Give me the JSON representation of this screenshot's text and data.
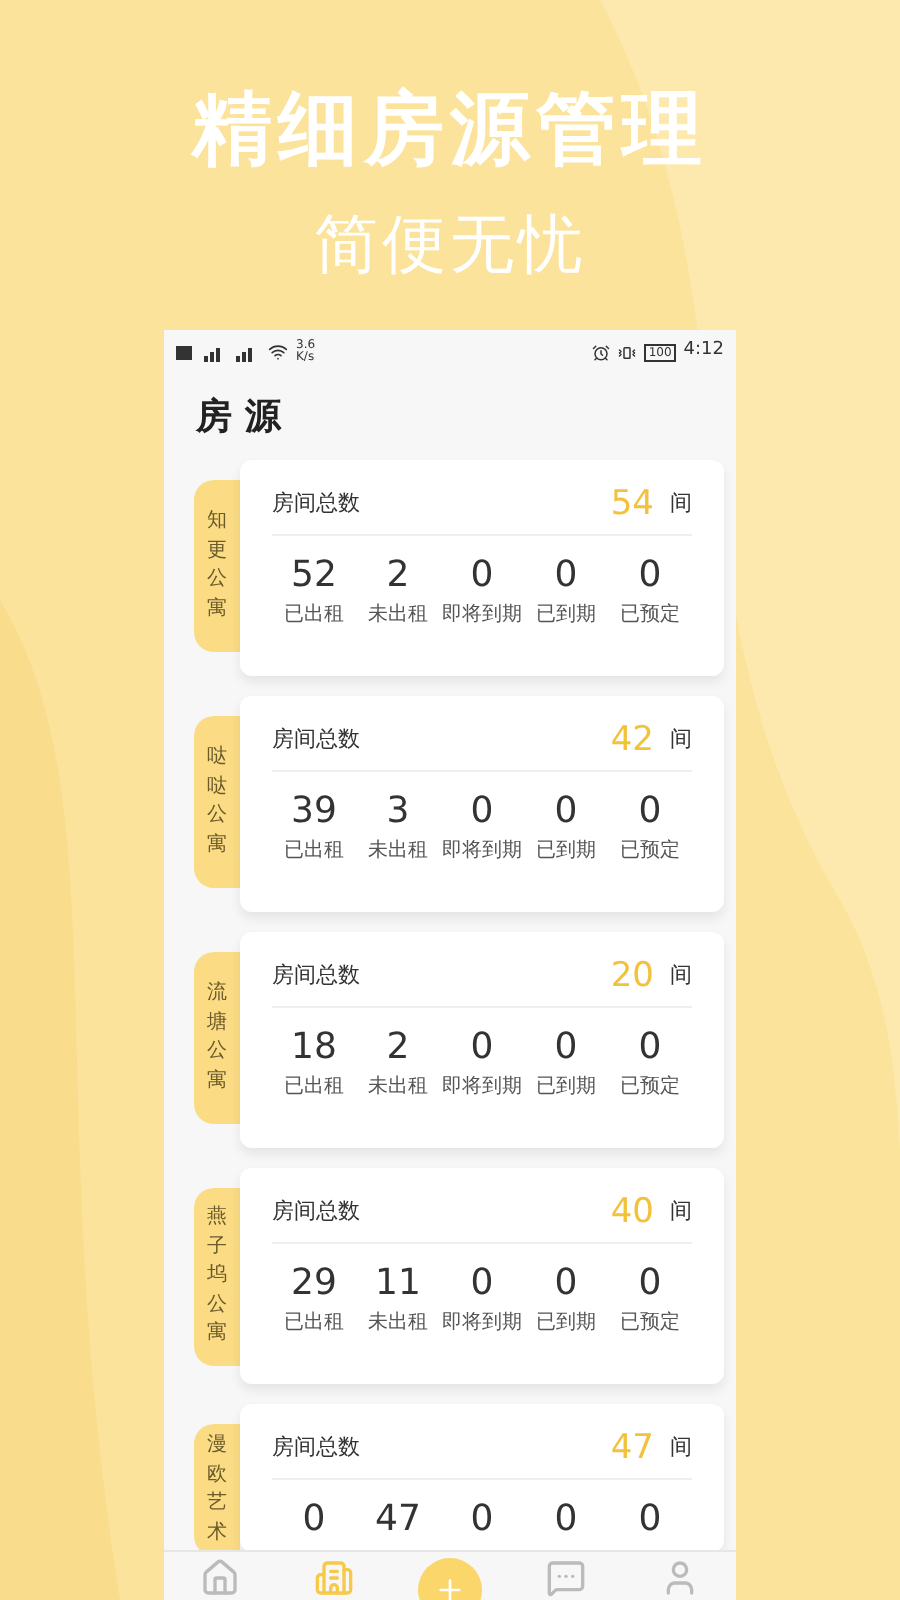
{
  "headline": "精细房源管理",
  "subheadline": "简便无忧",
  "status_bar": {
    "speed": "3.6",
    "speed_unit": "K/s",
    "battery": "100",
    "time": "4:12"
  },
  "page_title": "房 源",
  "properties": [
    {
      "name": "知更公寓",
      "total_label": "房间总数",
      "total": "54",
      "unit": "间",
      "stats": [
        {
          "value": "52",
          "label": "已出租"
        },
        {
          "value": "2",
          "label": "未出租"
        },
        {
          "value": "0",
          "label": "即将到期"
        },
        {
          "value": "0",
          "label": "已到期"
        },
        {
          "value": "0",
          "label": "已预定"
        }
      ]
    },
    {
      "name": "哒哒公寓",
      "total_label": "房间总数",
      "total": "42",
      "unit": "间",
      "stats": [
        {
          "value": "39",
          "label": "已出租"
        },
        {
          "value": "3",
          "label": "未出租"
        },
        {
          "value": "0",
          "label": "即将到期"
        },
        {
          "value": "0",
          "label": "已到期"
        },
        {
          "value": "0",
          "label": "已预定"
        }
      ]
    },
    {
      "name": "流塘公寓",
      "total_label": "房间总数",
      "total": "20",
      "unit": "间",
      "stats": [
        {
          "value": "18",
          "label": "已出租"
        },
        {
          "value": "2",
          "label": "未出租"
        },
        {
          "value": "0",
          "label": "即将到期"
        },
        {
          "value": "0",
          "label": "已到期"
        },
        {
          "value": "0",
          "label": "已预定"
        }
      ]
    },
    {
      "name": "燕子坞公寓",
      "total_label": "房间总数",
      "total": "40",
      "unit": "间",
      "stats": [
        {
          "value": "29",
          "label": "已出租"
        },
        {
          "value": "11",
          "label": "未出租"
        },
        {
          "value": "0",
          "label": "即将到期"
        },
        {
          "value": "0",
          "label": "已到期"
        },
        {
          "value": "0",
          "label": "已预定"
        }
      ]
    },
    {
      "name": "漫欧艺术",
      "total_label": "房间总数",
      "total": "47",
      "unit": "间",
      "stats": [
        {
          "value": "0"
        },
        {
          "value": "47"
        },
        {
          "value": "0"
        },
        {
          "value": "0"
        },
        {
          "value": "0"
        }
      ]
    }
  ],
  "tab_bar": [
    {
      "kind": "home",
      "selected": false
    },
    {
      "kind": "rooms",
      "selected": true
    },
    {
      "kind": "add",
      "selected": false
    },
    {
      "kind": "messages",
      "selected": false
    },
    {
      "kind": "profile",
      "selected": false
    }
  ]
}
